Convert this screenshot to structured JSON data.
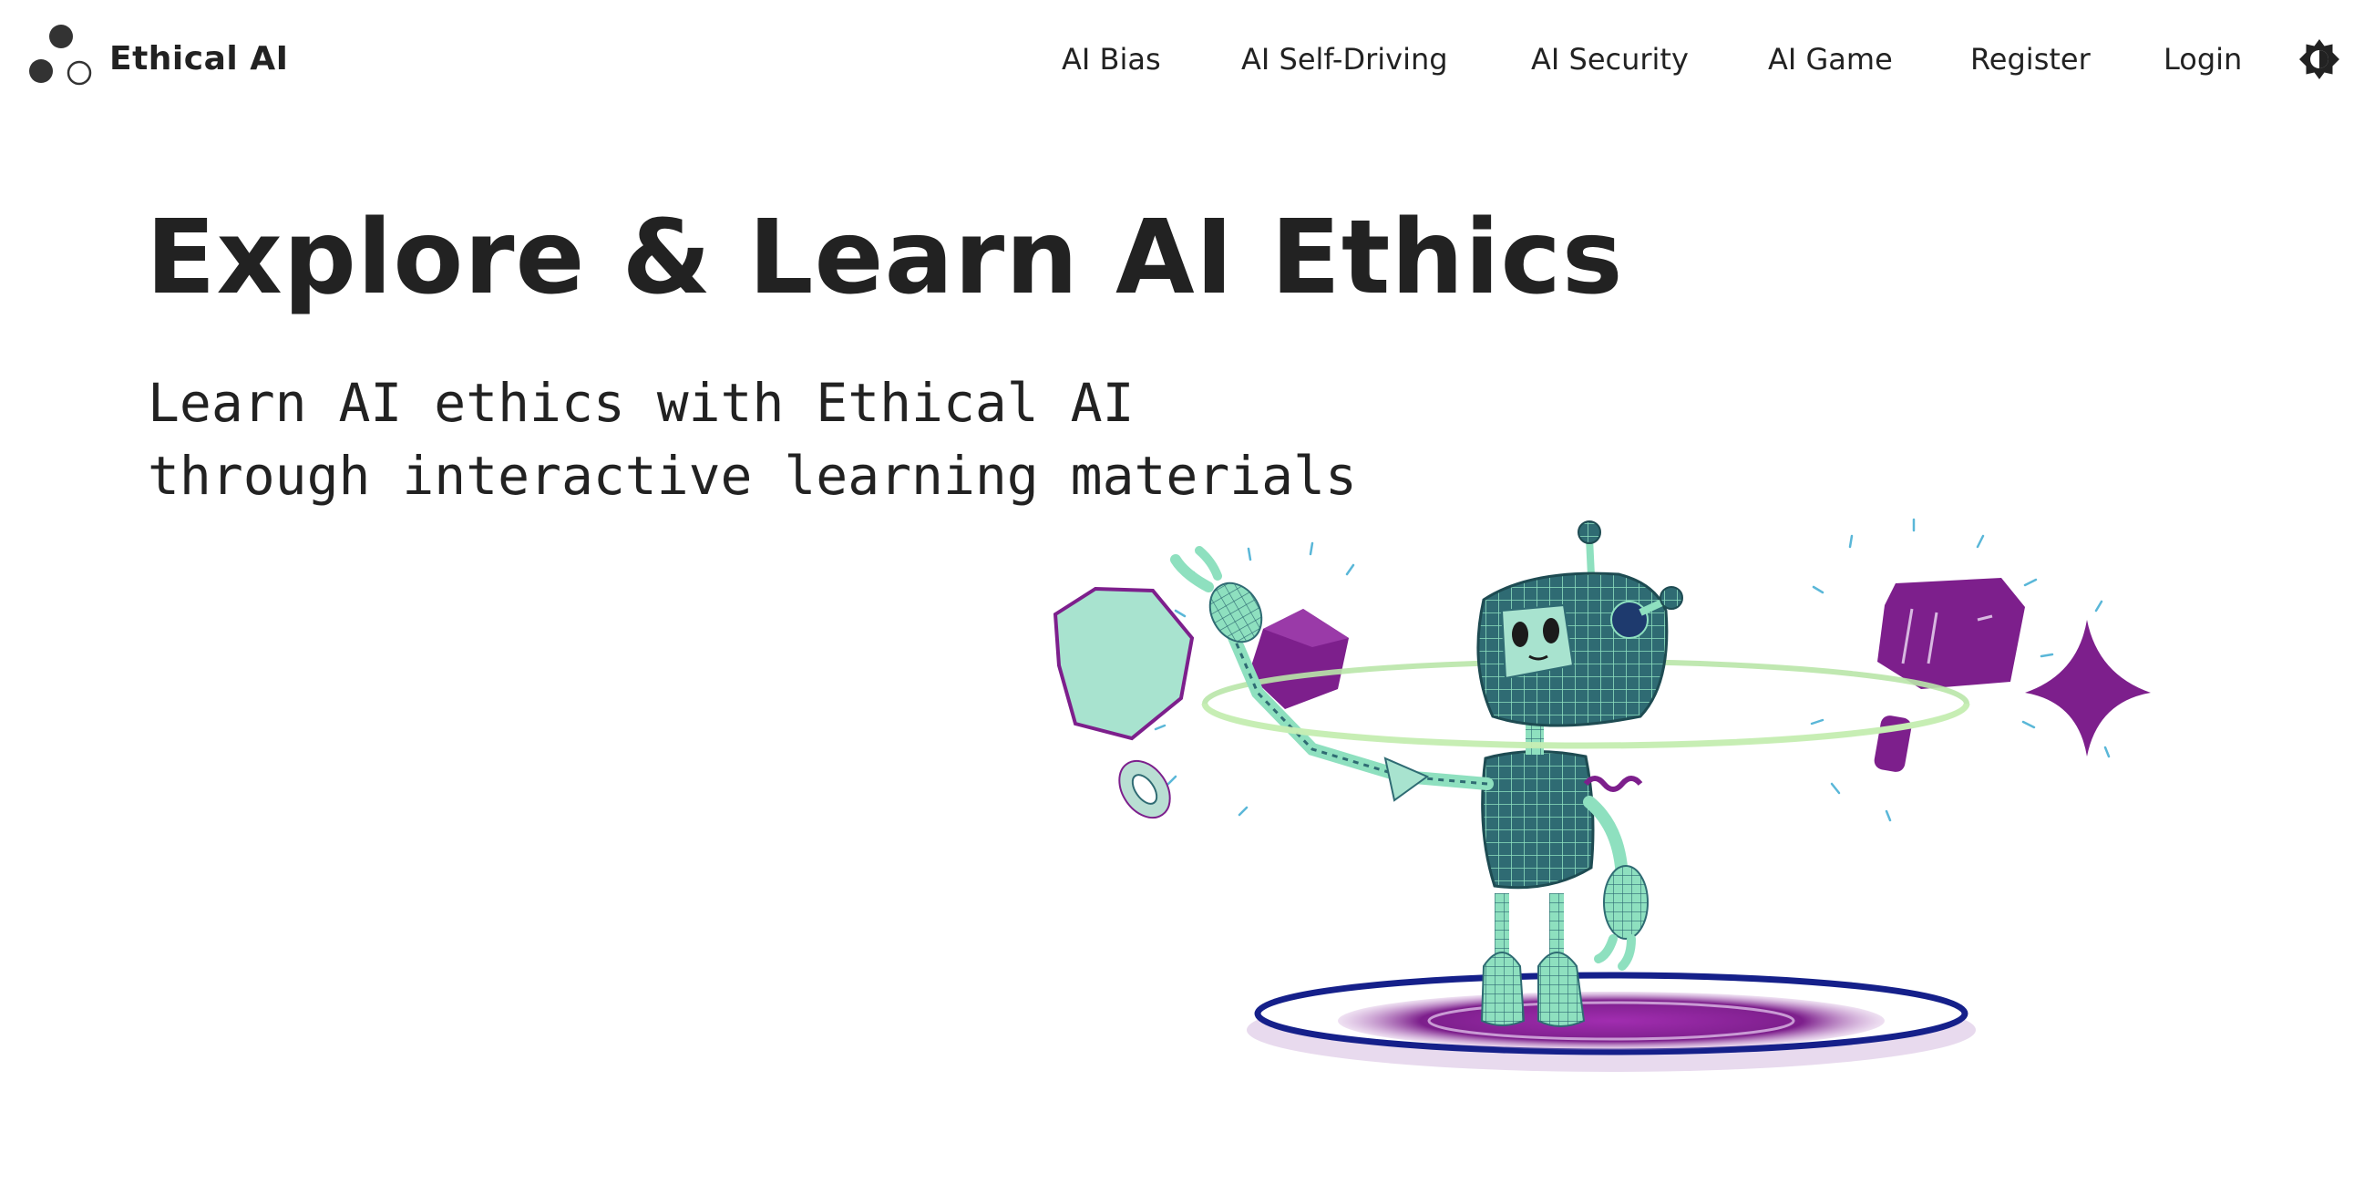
{
  "brand": {
    "name": "Ethical AI",
    "logo_icon": "three-dots-logo-icon"
  },
  "nav": {
    "items": [
      {
        "label": "AI Bias"
      },
      {
        "label": "AI Self-Driving"
      },
      {
        "label": "AI Security"
      },
      {
        "label": "AI Game"
      },
      {
        "label": "Register"
      },
      {
        "label": "Login"
      }
    ],
    "theme_toggle_icon": "brightness-toggle-icon"
  },
  "hero": {
    "title": "Explore & Learn AI Ethics",
    "subtitle": "Learn AI ethics with Ethical AI\nthrough interactive learning materials",
    "illustration": "robot-hologram-illustration"
  },
  "colors": {
    "text": "#222222",
    "background": "#ffffff",
    "robot_teal": "#2f6b73",
    "robot_mint": "#8ee0bf",
    "accent_purple": "#7d1f8c",
    "hexagon_mint": "#a8e3cf",
    "platform_navy": "#15208a"
  }
}
